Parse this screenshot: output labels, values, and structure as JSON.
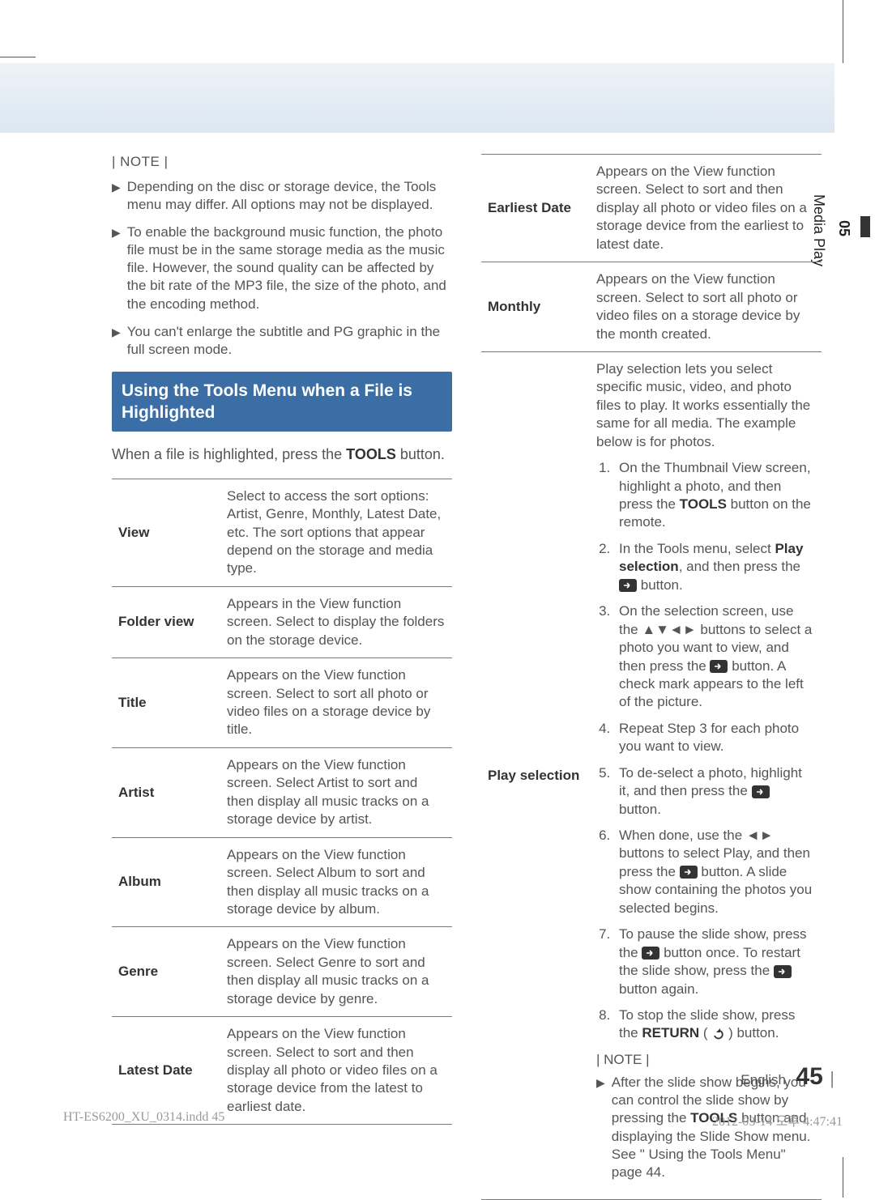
{
  "side_tab": {
    "num": "05",
    "label": "Media Play"
  },
  "left": {
    "note_label": "| NOTE |",
    "bullets": [
      "Depending on the disc or storage device, the Tools menu may differ. All options may not be displayed.",
      "To enable the background music function, the photo file must be in the same storage media as the music file. However, the sound quality can be affected by the bit rate of the MP3 file, the size of the photo, and the encoding method.",
      "You can't enlarge the subtitle and PG graphic in the full screen mode."
    ],
    "section_title": "Using the Tools Menu when a File is Highlighted",
    "intro_a": "When a file is highlighted, press the ",
    "intro_b": "TOOLS",
    "intro_c": " button.",
    "rows": [
      {
        "term": "View",
        "desc": "Select to access the sort options: Artist, Genre, Monthly, Latest Date, etc. The sort options that appear depend on the storage and media type."
      },
      {
        "term": "Folder view",
        "desc": "Appears in the View function screen. Select to display the folders on the storage device."
      },
      {
        "term": "Title",
        "desc": "Appears on the View function screen. Select to sort all photo or video files on a storage device by title."
      },
      {
        "term": "Artist",
        "desc": "Appears on the View function screen. Select Artist to sort and then display all music tracks on a storage device by artist."
      },
      {
        "term": "Album",
        "desc": "Appears on the View function screen. Select Album to sort and then display all music tracks on a storage device by album."
      },
      {
        "term": "Genre",
        "desc": "Appears on the View function screen. Select Genre to sort and then display all music tracks on a storage device by genre."
      },
      {
        "term": "Latest Date",
        "desc": "Appears on the View function screen. Select to sort and then display all photo or video files on a storage device from the latest to earliest date."
      }
    ]
  },
  "right": {
    "rows_top": [
      {
        "term": "Earliest Date",
        "desc": "Appears on the View function screen. Select to sort and then display all photo or video files on a storage device from the earliest to latest date."
      },
      {
        "term": "Monthly",
        "desc": "Appears on the View function screen. Select to sort all photo or video files on a storage device by the month created."
      }
    ],
    "play_term": "Play selection",
    "play_intro": "Play selection lets you select specific music, video, and photo files to play. It works essentially the same for all media. The example below is for photos.",
    "steps": {
      "s1a": "On the Thumbnail View screen, highlight a photo, and then press the ",
      "s1b": "TOOLS",
      "s1c": " button on the remote.",
      "s2a": "In the Tools menu, select ",
      "s2b": "Play selection",
      "s2c": ", and then press the ",
      "s2d": " button.",
      "s3a": "On the selection screen, use the ▲▼◄► buttons to select a photo you want to view, and then press the ",
      "s3b": " button. A check mark appears to the left of the picture.",
      "s4": "Repeat Step 3 for each photo you want to view.",
      "s5a": "To de-select a photo, highlight it, and then press the ",
      "s5b": " button.",
      "s6a": "When done, use the ◄► buttons to select Play, and then press the ",
      "s6b": " button. A slide show containing the photos you selected begins.",
      "s7a": "To pause the slide show, press the ",
      "s7b": " button once. To restart the slide show, press the ",
      "s7c": " button again.",
      "s8a": "To stop the slide show, press the ",
      "s8b": "RETURN",
      "s8c": " (",
      "s8d": ") button."
    },
    "note_label": "| NOTE |",
    "note_bullet_a": "After the slide show begins, you can control the slide show by pressing the ",
    "note_bullet_b": "TOOLS",
    "note_bullet_c": " button and displaying the Slide Show menu. See \" Using the Tools Menu\" page 44."
  },
  "footer": {
    "lang": "English",
    "page": "45",
    "print_left": "HT-ES6200_XU_0314.indd   45",
    "print_right": "2012-03-14   오후 4:47:41"
  }
}
